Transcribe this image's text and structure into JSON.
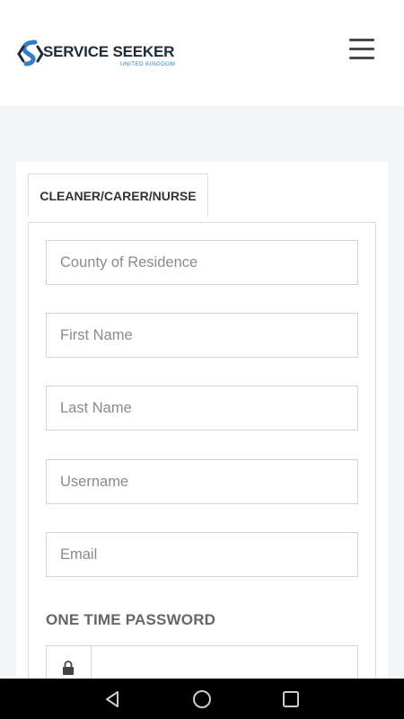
{
  "header": {
    "logo": {
      "title": "SERVICE SEEKER",
      "subtitle": "UNITED KINGDOM"
    },
    "menu_icon": "hamburger-icon"
  },
  "form": {
    "tab_label": "CLEANER/CARER/NURSE",
    "fields": {
      "county": {
        "placeholder": "County of Residence",
        "value": ""
      },
      "first_name": {
        "placeholder": "First Name",
        "value": ""
      },
      "last_name": {
        "placeholder": "Last Name",
        "value": ""
      },
      "username": {
        "placeholder": "Username",
        "value": ""
      },
      "email": {
        "placeholder": "Email",
        "value": ""
      }
    },
    "otp": {
      "label": "ONE TIME PASSWORD",
      "icon": "lock-icon",
      "value": ""
    }
  },
  "system_nav": {
    "back": "back-triangle-icon",
    "home": "home-circle-icon",
    "recents": "recents-square-icon"
  },
  "colors": {
    "brand_blue": "#2f7fc2",
    "brand_dark": "#1f2a3a",
    "page_bg": "#f4f5f7"
  }
}
